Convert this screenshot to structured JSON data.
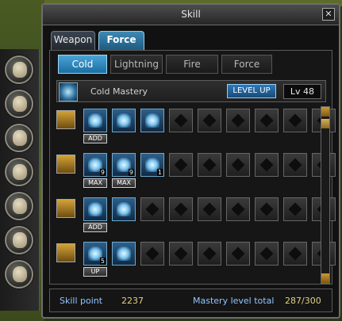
{
  "window": {
    "title": "Skill",
    "close_glyph": "✕"
  },
  "tabs": {
    "main": [
      "Weapon",
      "Force"
    ],
    "sub": [
      "Cold",
      "Lightning",
      "Fire",
      "Force"
    ]
  },
  "mastery": {
    "name": "Cold Mastery",
    "levelup_label": "LEVEL UP",
    "level": "Lv 48"
  },
  "sidebar": {
    "icons": [
      "portrait-icon",
      "gear-icon",
      "book-icon",
      "boot-icon",
      "handshake-icon",
      "scroll-icon",
      "ring-icon"
    ]
  },
  "rows": [
    {
      "badge_icon": "cold-badge-icon",
      "slots": [
        {
          "state": "learned",
          "count": ""
        },
        {
          "state": "learned",
          "count": ""
        },
        {
          "state": "learned",
          "count": ""
        },
        {
          "state": "disabled",
          "count": ""
        },
        {
          "state": "disabled",
          "count": ""
        },
        {
          "state": "disabled",
          "count": ""
        },
        {
          "state": "disabled",
          "count": ""
        },
        {
          "state": "disabled",
          "count": ""
        },
        {
          "state": "disabled",
          "count": ""
        }
      ],
      "labels": [
        "ADD"
      ]
    },
    {
      "badge_icon": "shield-badge-icon",
      "slots": [
        {
          "state": "learned",
          "count": "9"
        },
        {
          "state": "learned",
          "count": "9"
        },
        {
          "state": "learned",
          "count": "1"
        },
        {
          "state": "disabled",
          "count": ""
        },
        {
          "state": "disabled",
          "count": ""
        },
        {
          "state": "disabled",
          "count": ""
        },
        {
          "state": "disabled",
          "count": ""
        },
        {
          "state": "disabled",
          "count": ""
        },
        {
          "state": "disabled",
          "count": ""
        }
      ],
      "labels": [
        "MAX",
        "MAX"
      ]
    },
    {
      "badge_icon": "arrow-badge-icon",
      "slots": [
        {
          "state": "learned",
          "count": ""
        },
        {
          "state": "learned",
          "count": ""
        },
        {
          "state": "disabled",
          "count": ""
        },
        {
          "state": "disabled",
          "count": ""
        },
        {
          "state": "disabled",
          "count": ""
        },
        {
          "state": "disabled",
          "count": ""
        },
        {
          "state": "disabled",
          "count": ""
        },
        {
          "state": "disabled",
          "count": ""
        },
        {
          "state": "disabled",
          "count": ""
        }
      ],
      "labels": [
        "ADD"
      ]
    },
    {
      "badge_icon": "wing-badge-icon",
      "slots": [
        {
          "state": "learned",
          "count": "5"
        },
        {
          "state": "learned",
          "count": ""
        },
        {
          "state": "disabled",
          "count": ""
        },
        {
          "state": "disabled",
          "count": ""
        },
        {
          "state": "disabled",
          "count": ""
        },
        {
          "state": "disabled",
          "count": ""
        },
        {
          "state": "disabled",
          "count": ""
        },
        {
          "state": "disabled",
          "count": ""
        },
        {
          "state": "disabled",
          "count": ""
        }
      ],
      "labels": [
        "UP"
      ]
    }
  ],
  "footer": {
    "skill_point_label": "Skill point",
    "skill_point_value": "2237",
    "mastery_total_label": "Mastery level total",
    "mastery_total_value": "287/300"
  }
}
